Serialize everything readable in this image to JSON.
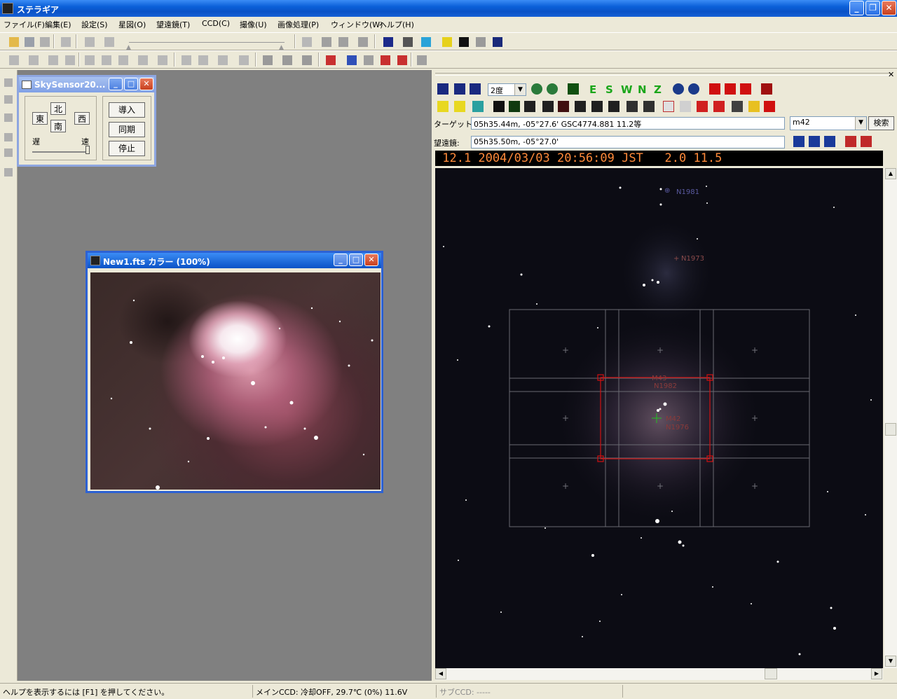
{
  "app": {
    "title": "ステラギア"
  },
  "menu": [
    "ファイル(F)",
    "編集(E)",
    "設定(S)",
    "星図(O)",
    "望遠鏡(T)",
    "CCD(C)",
    "撮像(U)",
    "画像処理(P)",
    "ウィンドウ(W)",
    "ヘルプ(H)"
  ],
  "skysensor": {
    "title": "SkySensor20...",
    "dir_north": "北",
    "dir_east": "東",
    "dir_west": "西",
    "dir_south": "南",
    "slow": "遅",
    "fast": "速",
    "btn_goto": "導入",
    "btn_sync": "同期",
    "btn_stop": "停止"
  },
  "fits": {
    "title": "New1.fts カラー (100%)"
  },
  "chart": {
    "fov_select": "2度",
    "compass": [
      "E",
      "S",
      "W",
      "N",
      "Z"
    ],
    "target_label": "ターゲット:",
    "target_value": "05h35.44m, -05°27.6'  GSC4774.881 11.2等",
    "scope_label": "望遠鏡:",
    "scope_value": "05h35.50m, -05°27.0'",
    "search_value": "m42",
    "search_button": "検索",
    "info_bar": " 12.1 2004/03/03 20:56:09 JST   2.0 11.5",
    "objects": [
      "N1981",
      "N1973",
      "M43",
      "N1982",
      "M42",
      "N1976"
    ]
  },
  "status": {
    "help": "ヘルプを表示するには [F1] を押してください。",
    "main_ccd": "メインCCD: 冷却OFF, 29.7℃ (0%) 11.6V",
    "sub_ccd": "サブCCD: -----"
  },
  "colors": {
    "titlebar": "#0a52c6",
    "info_text": "#ff8a3a",
    "sky_bg": "#0c0c14",
    "frame_red": "#d01010"
  }
}
